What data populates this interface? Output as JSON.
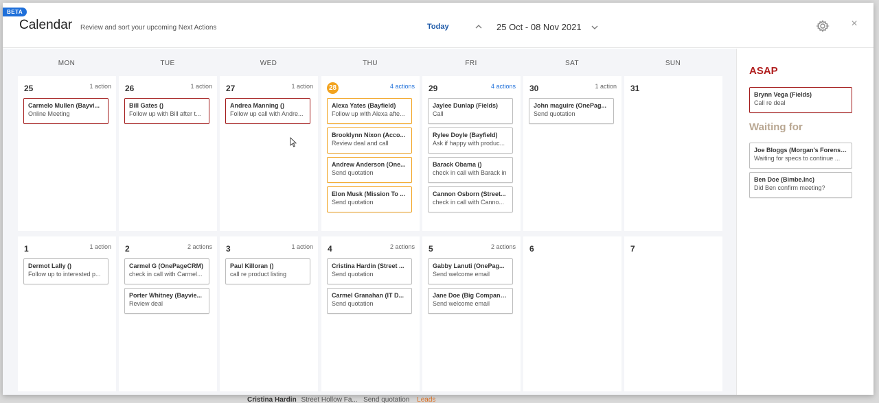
{
  "header": {
    "badge": "BETA",
    "title": "Calendar",
    "subtitle": "Review and sort your upcoming Next Actions",
    "today_label": "Today",
    "range_label": "25 Oct - 08 Nov 2021",
    "icons": {
      "prev": "chevron-up-icon",
      "next": "chevron-down-icon",
      "settings": "gear-icon",
      "close": "close-icon"
    },
    "close_glyph": "×"
  },
  "weekdays": [
    "MON",
    "TUE",
    "WED",
    "THU",
    "FRI",
    "SAT",
    "SUN"
  ],
  "weeks": [
    [
      {
        "num": "25",
        "count": "1 action",
        "items": [
          {
            "title": "Carmelo Mullen (Bayvi...",
            "sub": "Online Meeting",
            "color": "red"
          }
        ]
      },
      {
        "num": "26",
        "count": "1 action",
        "items": [
          {
            "title": "Bill Gates ()",
            "sub": "Follow up with Bill after t...",
            "color": "red"
          }
        ]
      },
      {
        "num": "27",
        "count": "1 action",
        "items": [
          {
            "title": "Andrea Manning ()",
            "sub": "Follow up call with Andre...",
            "color": "red"
          }
        ]
      },
      {
        "num": "28",
        "today": true,
        "count": "4 actions",
        "items": [
          {
            "title": "Alexa Yates (Bayfield)",
            "sub": "Follow up with Alexa afte...",
            "color": "orange"
          },
          {
            "title": "Brooklynn Nixon (Acco...",
            "sub": "Review deal and call",
            "color": "orange"
          },
          {
            "title": "Andrew Anderson (One...",
            "sub": "Send quotation",
            "color": "orange"
          },
          {
            "title": "Elon Musk (Mission To ...",
            "sub": "Send quotation",
            "color": "orange"
          }
        ]
      },
      {
        "num": "29",
        "count": "4 actions",
        "items": [
          {
            "title": "Jaylee Dunlap (Fields)",
            "sub": "Call",
            "color": "grey"
          },
          {
            "title": "Rylee Doyle (Bayfield)",
            "sub": "Ask if happy with produc...",
            "color": "grey"
          },
          {
            "title": "Barack Obama ()",
            "sub": "check in call with Barack in",
            "color": "grey"
          },
          {
            "title": "Cannon Osborn (Street...",
            "sub": "check in call with Canno...",
            "color": "grey"
          }
        ]
      },
      {
        "num": "30",
        "count": "1 action",
        "items": [
          {
            "title": "John maguire (OnePag...",
            "sub": "Send quotation",
            "color": "grey"
          }
        ]
      },
      {
        "num": "31",
        "count": "",
        "items": []
      }
    ],
    [
      {
        "num": "1",
        "count": "1 action",
        "items": [
          {
            "title": "Dermot Lally ()",
            "sub": "Follow up to interested p...",
            "color": "grey"
          }
        ]
      },
      {
        "num": "2",
        "count": "2 actions",
        "items": [
          {
            "title": "Carmel G (OnePageCRM)",
            "sub": "check in call with Carmel...",
            "color": "grey"
          },
          {
            "title": "Porter Whitney (Bayvie...",
            "sub": "Review deal",
            "color": "grey"
          }
        ]
      },
      {
        "num": "3",
        "count": "1 action",
        "items": [
          {
            "title": "Paul Killoran ()",
            "sub": "call re product listing",
            "color": "grey"
          }
        ]
      },
      {
        "num": "4",
        "count": "2 actions",
        "items": [
          {
            "title": "Cristina Hardin (Street ...",
            "sub": "Send quotation",
            "color": "grey"
          },
          {
            "title": "Carmel Granahan (IT D...",
            "sub": "Send quotation",
            "color": "grey"
          }
        ]
      },
      {
        "num": "5",
        "count": "2 actions",
        "items": [
          {
            "title": "Gabby Lanuti (OnePag...",
            "sub": "Send welcome email",
            "color": "grey"
          },
          {
            "title": "Jane Doe (Big Company...",
            "sub": "Send welcome email",
            "color": "grey"
          }
        ]
      },
      {
        "num": "6",
        "count": "",
        "items": []
      },
      {
        "num": "7",
        "count": "",
        "items": []
      }
    ]
  ],
  "sidebar": {
    "asap_title": "ASAP",
    "asap_items": [
      {
        "title": "Brynn Vega (Fields)",
        "sub": "Call re deal",
        "color": "red"
      }
    ],
    "waiting_title": "Waiting for",
    "waiting_items": [
      {
        "title": "Joe Bloggs (Morgan's Forensi...",
        "sub": "Waiting for specs to continue ...",
        "color": "grey"
      },
      {
        "title": "Ben Doe (Bimbe.Inc)",
        "sub": "Did Ben confirm meeting?",
        "color": "grey"
      }
    ]
  },
  "underlay": {
    "name": "Cristina Hardin",
    "company": "Street Hollow Fa...",
    "action": "Send quotation",
    "lead": "Leads"
  },
  "colors": {
    "accent": "#1e6fd9",
    "today": "#f2a31f",
    "overdue": "#a31b1b",
    "asap": "#b01e1e",
    "waiting": "#b8a691"
  }
}
